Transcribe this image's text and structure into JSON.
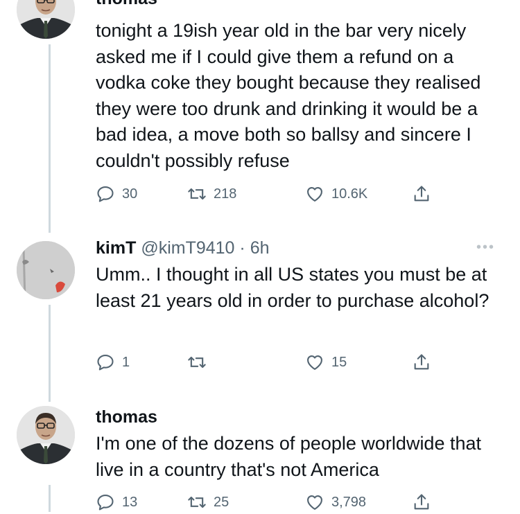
{
  "tweets": [
    {
      "name": "thomas",
      "handle": "",
      "time": "",
      "text": "tonight a 19ish year old in the bar very nicely asked me if I could give them a refund on a vodka coke they bought because they realised they were too drunk and drinking it would be a bad idea, a move both so ballsy and sincere I couldn't possibly refuse",
      "replies": "30",
      "retweets": "218",
      "likes": "10.6K"
    },
    {
      "name": "kimT",
      "handle": "@kimT9410",
      "time": "· 6h",
      "text": "Umm.. I thought in all US states you must be at least 21 years old in order to purchase alcohol?",
      "replies": "1",
      "retweets": "",
      "likes": "15"
    },
    {
      "name": "thomas",
      "handle": "",
      "time": "",
      "text": "I'm one of the dozens of people worldwide that live in a country that's not America",
      "replies": "13",
      "retweets": "25",
      "likes": "3,798"
    }
  ],
  "icons": {
    "reply": "reply-icon",
    "retweet": "retweet-icon",
    "like": "like-icon",
    "share": "share-icon",
    "more": "more-icon"
  },
  "colors": {
    "text": "#0f1419",
    "muted": "#536471",
    "thread_line": "#cfd9de"
  }
}
